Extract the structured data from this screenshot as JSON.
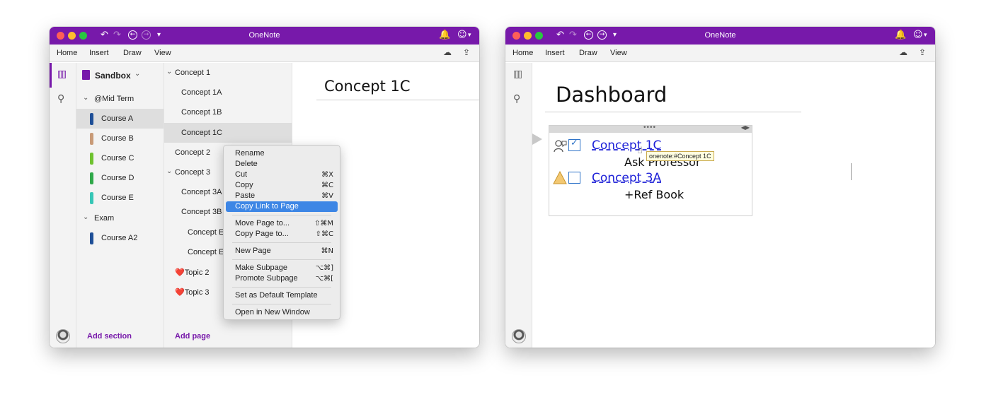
{
  "left_window": {
    "title": "OneNote",
    "menu": [
      "Home",
      "Insert",
      "Draw",
      "View"
    ],
    "notebook": "Sandbox",
    "sections": [
      {
        "kind": "group",
        "label": "@Mid Term"
      },
      {
        "kind": "section",
        "label": "Course A",
        "color": "#1e4f97",
        "selected": true
      },
      {
        "kind": "section",
        "label": "Course B",
        "color": "#c89a77"
      },
      {
        "kind": "section",
        "label": "Course C",
        "color": "#6fc22f"
      },
      {
        "kind": "section",
        "label": "Course D",
        "color": "#2fa849"
      },
      {
        "kind": "section",
        "label": "Course E",
        "color": "#36c6b6"
      },
      {
        "kind": "group",
        "label": "Exam"
      },
      {
        "kind": "section",
        "label": "Course A2",
        "color": "#1e4f97"
      }
    ],
    "add_section_label": "Add section",
    "pages": [
      {
        "label": "Concept 1",
        "level": 0,
        "expandable": true
      },
      {
        "label": "Concept 1A",
        "level": 1
      },
      {
        "label": "Concept 1B",
        "level": 1
      },
      {
        "label": "Concept 1C",
        "level": 1,
        "selected": true
      },
      {
        "label": "Concept 2",
        "level": 0
      },
      {
        "label": "Concept 3",
        "level": 0,
        "expandable": true
      },
      {
        "label": "Concept 3A",
        "level": 1
      },
      {
        "label": "Concept 3B",
        "level": 1
      },
      {
        "label": "Concept E",
        "level": 2
      },
      {
        "label": "Concept E",
        "level": 2
      },
      {
        "label": "❤️Topic 2",
        "level": 0
      },
      {
        "label": "❤️Topic 3",
        "level": 0
      }
    ],
    "add_page_label": "Add page",
    "page_title": "Concept 1C",
    "context_menu": [
      {
        "label": "Rename",
        "shortcut": ""
      },
      {
        "label": "Delete",
        "shortcut": ""
      },
      {
        "label": "Cut",
        "shortcut": "⌘X"
      },
      {
        "label": "Copy",
        "shortcut": "⌘C"
      },
      {
        "label": "Paste",
        "shortcut": "⌘V"
      },
      {
        "label": "Copy Link to Page",
        "shortcut": "",
        "highlighted": true
      },
      {
        "separator": true
      },
      {
        "label": "Move Page to...",
        "shortcut": "⇧⌘M"
      },
      {
        "label": "Copy Page to...",
        "shortcut": "⇧⌘C"
      },
      {
        "separator": true
      },
      {
        "label": "New Page",
        "shortcut": "⌘N"
      },
      {
        "separator": true
      },
      {
        "label": "Make Subpage",
        "shortcut": "⌥⌘]"
      },
      {
        "label": "Promote Subpage",
        "shortcut": "⌥⌘["
      },
      {
        "separator": true
      },
      {
        "label": "Set as Default Template",
        "shortcut": ""
      },
      {
        "separator": true
      },
      {
        "label": "Open in New Window",
        "shortcut": ""
      }
    ]
  },
  "right_window": {
    "title": "OneNote",
    "menu": [
      "Home",
      "Insert",
      "Draw",
      "View"
    ],
    "page_title": "Dashboard",
    "items": [
      {
        "link": "Concept 1C",
        "note": "Ask Professor",
        "tags": [
          "question-person-icon",
          "checked-checkbox-icon"
        ]
      },
      {
        "link": "Concept 3A",
        "note": "+Ref Book",
        "tags": [
          "warning-triangle-icon",
          "unchecked-checkbox-icon"
        ]
      }
    ],
    "tooltip": "onenote:#Concept 1C"
  },
  "colors": {
    "accent": "#7719aa",
    "highlight": "#3d86e5",
    "link": "#1f22d8"
  }
}
